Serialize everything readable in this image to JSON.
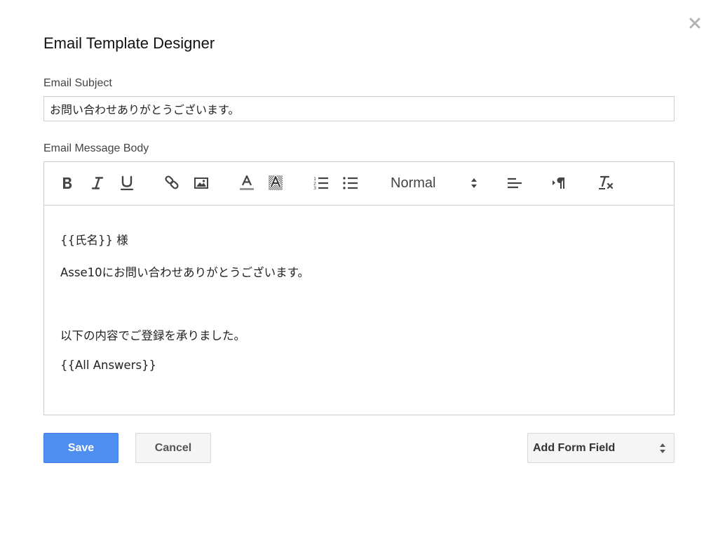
{
  "dialog": {
    "title": "Email Template Designer",
    "close_icon": "close-icon"
  },
  "subject": {
    "label": "Email Subject",
    "value": "お問い合わせありがとうございます。"
  },
  "body": {
    "label": "Email Message Body",
    "lines": [
      "{{氏名}} 様",
      "Asse10にお問い合わせありがとうございます。",
      "以下の内容でご登録を承りました。",
      "{{All Answers}}"
    ]
  },
  "toolbar": {
    "format_value": "Normal",
    "buttons": [
      "bold-icon",
      "italic-icon",
      "underline-icon",
      "link-icon",
      "image-icon",
      "text-color-icon",
      "background-color-icon",
      "ordered-list-icon",
      "bullet-list-icon",
      "align-left-icon",
      "text-direction-icon",
      "clear-formatting-icon"
    ]
  },
  "footer": {
    "save_label": "Save",
    "cancel_label": "Cancel",
    "add_field_label": "Add Form Field"
  },
  "colors": {
    "primary": "#4d8ef0",
    "border": "#cccccc",
    "text": "#222222"
  }
}
